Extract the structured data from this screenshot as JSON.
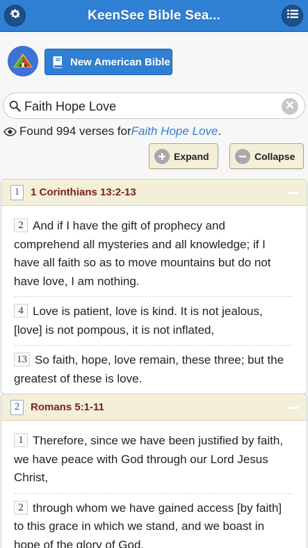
{
  "header": {
    "title": "KeenSee Bible Sea...",
    "left_icon": "gear-icon",
    "right_icon": "list-icon"
  },
  "version": {
    "label": "New American Bible",
    "icon": "book-icon"
  },
  "search": {
    "value": "Faith Hope Love",
    "placeholder": "",
    "clear_icon": "clear-icon"
  },
  "results": {
    "prefix": "Found 994 verses for ",
    "query": "Faith Hope Love",
    "suffix": "."
  },
  "actions": {
    "expand_label": "Expand",
    "collapse_label": "Collapse"
  },
  "passages": [
    {
      "index": "1",
      "reference": "1 Corinthians 13:2-13",
      "verses": [
        {
          "num": "2",
          "text": "And if I have the gift of prophecy and comprehend all mysteries and all knowledge; if I have all faith so as to move mountains but do not have love, I am nothing."
        },
        {
          "num": "4",
          "text": "Love is patient, love is kind. It is not jealous, [love] is not pompous, it is not inflated,"
        },
        {
          "num": "13",
          "text": "So faith, hope, love remain, these three; but the greatest of these is love."
        }
      ]
    },
    {
      "index": "2",
      "reference": "Romans 5:1-11",
      "verses": [
        {
          "num": "1",
          "text": "Therefore, since we have been justified by faith, we have peace with God through our Lord Jesus Christ,"
        },
        {
          "num": "2",
          "text": "through whom we have gained access [by faith] to this grace in which we stand, and we boast in hope of the glory of God."
        }
      ]
    }
  ],
  "colors": {
    "header_blue": "#2f7fd3",
    "passage_header": "#f3efd9",
    "reference_red": "#7a1f1f",
    "query_blue": "#2f7fd3"
  }
}
